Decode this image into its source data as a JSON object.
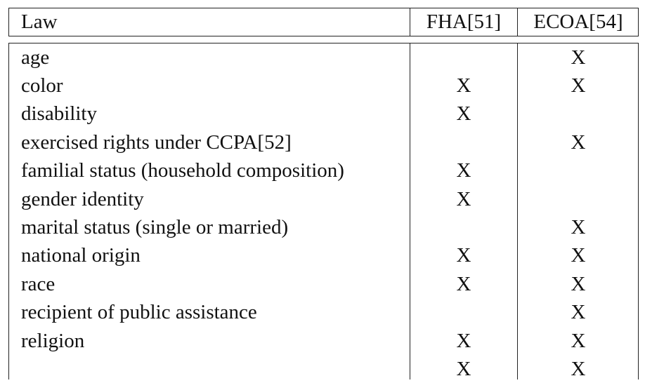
{
  "table": {
    "headers": {
      "law": "Law",
      "fha": "FHA[51]",
      "ecoa": "ECOA[54]"
    },
    "rows": [
      {
        "law": "age",
        "fha": "",
        "ecoa": "X"
      },
      {
        "law": "color",
        "fha": "X",
        "ecoa": "X"
      },
      {
        "law": "disability",
        "fha": "X",
        "ecoa": ""
      },
      {
        "law": "exercised rights under CCPA[52]",
        "fha": "",
        "ecoa": "X"
      },
      {
        "law": "familial status (household composition)",
        "fha": "X",
        "ecoa": ""
      },
      {
        "law": "gender identity",
        "fha": "X",
        "ecoa": ""
      },
      {
        "law": "marital status (single or married)",
        "fha": "",
        "ecoa": "X"
      },
      {
        "law": "national origin",
        "fha": "X",
        "ecoa": "X"
      },
      {
        "law": "race",
        "fha": "X",
        "ecoa": "X"
      },
      {
        "law": "recipient of public assistance",
        "fha": "",
        "ecoa": "X"
      },
      {
        "law": "religion",
        "fha": "X",
        "ecoa": "X"
      },
      {
        "law": "",
        "fha": "X",
        "ecoa": "X"
      }
    ]
  }
}
